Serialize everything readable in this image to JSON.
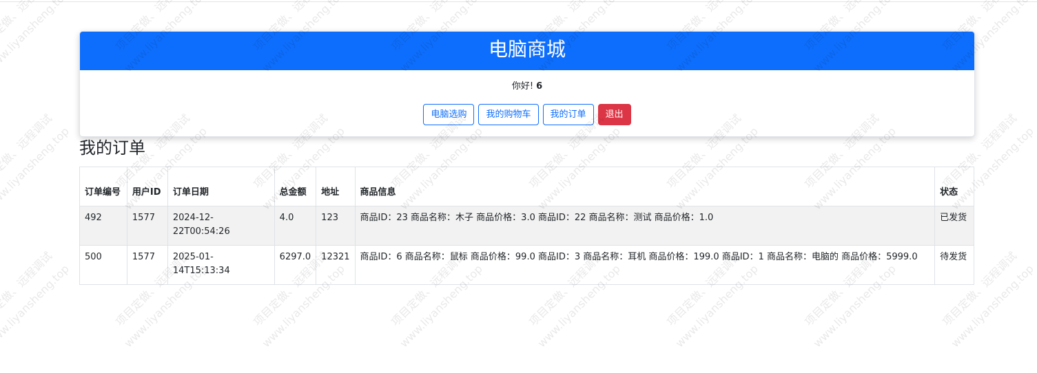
{
  "header": {
    "title": "电脑商城",
    "greeting": "你好!",
    "username": "6"
  },
  "nav": {
    "shop": "电脑选购",
    "cart": "我的购物车",
    "orders": "我的订单",
    "logout": "退出"
  },
  "page": {
    "title": "我的订单"
  },
  "table": {
    "headers": [
      "订单编号",
      "用户ID",
      "订单日期",
      "总金额",
      "地址",
      "商品信息",
      "状态"
    ],
    "rows": [
      {
        "id": "492",
        "user": "1577",
        "date": "2024-12-22T00:54:26",
        "total": "4.0",
        "address": "123",
        "items": "商品ID：23 商品名称：木子 商品价格：3.0 商品ID：22 商品名称：测试 商品价格：1.0",
        "status": "已发货"
      },
      {
        "id": "500",
        "user": "1577",
        "date": "2025-01-14T15:13:34",
        "total": "6297.0",
        "address": "12321",
        "items": "商品ID：6 商品名称：鼠标 商品价格：99.0 商品ID：3 商品名称：耳机 商品价格：199.0 商品ID：1 商品名称：电脑的 商品价格：5999.0",
        "status": "待发货"
      }
    ]
  },
  "watermark": {
    "line1": "项目定做、远程调试",
    "line2": "www.liyansheng.top"
  },
  "colors": {
    "primary": "#0d6efd",
    "danger": "#dc3545"
  }
}
